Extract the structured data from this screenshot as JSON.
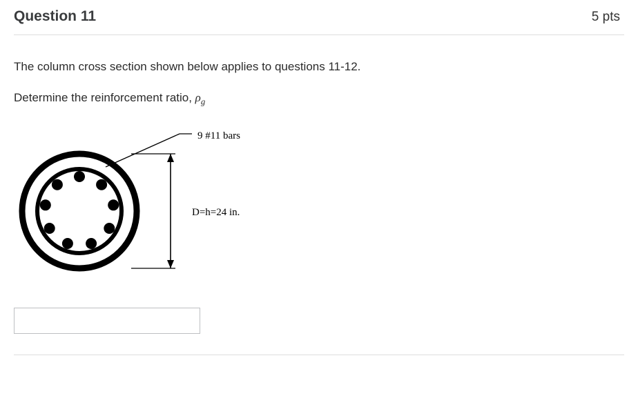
{
  "header": {
    "title": "Question 11",
    "points": "5 pts"
  },
  "body": {
    "intro": "The column cross section shown below applies to questions 11-12.",
    "prompt_prefix": "Determine the reinforcement ratio, ",
    "symbol": "ρ",
    "subscript": "g"
  },
  "figure": {
    "bars_label": "9 #11 bars",
    "dimension_label": "D=h=24 in."
  },
  "answer": {
    "value": ""
  }
}
